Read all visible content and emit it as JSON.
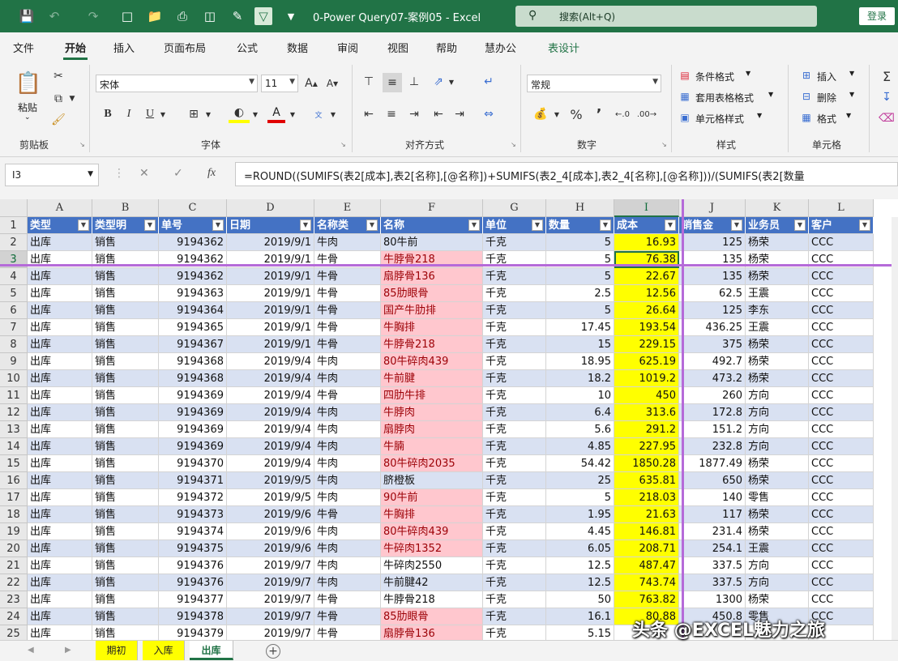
{
  "title_bar": {
    "doc_title": "0-Power Query07-案例05 - Excel",
    "search_placeholder": "搜索(Alt+Q)",
    "login_label": "登录"
  },
  "ribbon_tabs": [
    "文件",
    "开始",
    "插入",
    "页面布局",
    "公式",
    "数据",
    "审阅",
    "视图",
    "帮助",
    "慧办公",
    "表设计"
  ],
  "ribbon": {
    "clipboard": {
      "paste_label": "粘贴",
      "group_label": "剪贴板"
    },
    "font": {
      "name": "宋体",
      "size": "11",
      "group_label": "字体",
      "bold": "B",
      "italic": "I",
      "underline": "U"
    },
    "align": {
      "group_label": "对齐方式"
    },
    "number": {
      "format": "常规",
      "group_label": "数字",
      "percent": "%"
    },
    "styles": {
      "cond_format": "条件格式",
      "table_format": "套用表格格式",
      "cell_style": "单元格样式",
      "group_label": "样式"
    },
    "cells": {
      "insert": "插入",
      "delete": "删除",
      "format": "格式",
      "group_label": "单元格"
    }
  },
  "formula_bar": {
    "name_box": "I3",
    "fx": "fx",
    "formula": "=ROUND((SUMIFS(表2[成本],表2[名称],[@名称])+SUMIFS(表2_4[成本],表2_4[名称],[@名称]))/(SUMIFS(表2[数量"
  },
  "columns": [
    "A",
    "B",
    "C",
    "D",
    "E",
    "F",
    "G",
    "H",
    "I",
    "J",
    "K",
    "L"
  ],
  "table": {
    "headers": [
      "类型",
      "类型明",
      "单号",
      "日期",
      "名称类",
      "名称",
      "单位",
      "数量",
      "成本",
      "销售金",
      "业务员",
      "客户"
    ],
    "rows": [
      [
        "出库",
        "销售",
        "9194362",
        "2019/9/1",
        "牛肉",
        "80牛前",
        "千克",
        "5",
        "16.93",
        "125",
        "杨荣",
        "CCC"
      ],
      [
        "出库",
        "销售",
        "9194362",
        "2019/9/1",
        "牛骨",
        "牛脖骨218",
        "千克",
        "5",
        "76.38",
        "135",
        "杨荣",
        "CCC"
      ],
      [
        "出库",
        "销售",
        "9194362",
        "2019/9/1",
        "牛骨",
        "扇脖骨136",
        "千克",
        "5",
        "22.67",
        "135",
        "杨荣",
        "CCC"
      ],
      [
        "出库",
        "销售",
        "9194363",
        "2019/9/1",
        "牛骨",
        "85肋眼骨",
        "千克",
        "2.5",
        "12.56",
        "62.5",
        "王震",
        "CCC"
      ],
      [
        "出库",
        "销售",
        "9194364",
        "2019/9/1",
        "牛骨",
        "国产牛肋排",
        "千克",
        "5",
        "26.64",
        "125",
        "李东",
        "CCC"
      ],
      [
        "出库",
        "销售",
        "9194365",
        "2019/9/1",
        "牛骨",
        "牛胸排",
        "千克",
        "17.45",
        "193.54",
        "436.25",
        "王震",
        "CCC"
      ],
      [
        "出库",
        "销售",
        "9194367",
        "2019/9/1",
        "牛骨",
        "牛脖骨218",
        "千克",
        "15",
        "229.15",
        "375",
        "杨荣",
        "CCC"
      ],
      [
        "出库",
        "销售",
        "9194368",
        "2019/9/4",
        "牛肉",
        "80牛碎肉439",
        "千克",
        "18.95",
        "625.19",
        "492.7",
        "杨荣",
        "CCC"
      ],
      [
        "出库",
        "销售",
        "9194368",
        "2019/9/4",
        "牛肉",
        "牛前腱",
        "千克",
        "18.2",
        "1019.2",
        "473.2",
        "杨荣",
        "CCC"
      ],
      [
        "出库",
        "销售",
        "9194369",
        "2019/9/4",
        "牛骨",
        "四肋牛排",
        "千克",
        "10",
        "450",
        "260",
        "方向",
        "CCC"
      ],
      [
        "出库",
        "销售",
        "9194369",
        "2019/9/4",
        "牛肉",
        "牛脖肉",
        "千克",
        "6.4",
        "313.6",
        "172.8",
        "方向",
        "CCC"
      ],
      [
        "出库",
        "销售",
        "9194369",
        "2019/9/4",
        "牛肉",
        "扇脖肉",
        "千克",
        "5.6",
        "291.2",
        "151.2",
        "方向",
        "CCC"
      ],
      [
        "出库",
        "销售",
        "9194369",
        "2019/9/4",
        "牛肉",
        "牛腩",
        "千克",
        "4.85",
        "227.95",
        "232.8",
        "方向",
        "CCC"
      ],
      [
        "出库",
        "销售",
        "9194370",
        "2019/9/4",
        "牛肉",
        "80牛碎肉2035",
        "千克",
        "54.42",
        "1850.28",
        "1877.49",
        "杨荣",
        "CCC"
      ],
      [
        "出库",
        "销售",
        "9194371",
        "2019/9/5",
        "牛肉",
        "脐橙板",
        "千克",
        "25",
        "635.81",
        "650",
        "杨荣",
        "CCC"
      ],
      [
        "出库",
        "销售",
        "9194372",
        "2019/9/5",
        "牛肉",
        "90牛前",
        "千克",
        "5",
        "218.03",
        "140",
        "零售",
        "CCC"
      ],
      [
        "出库",
        "销售",
        "9194373",
        "2019/9/6",
        "牛骨",
        "牛胸排",
        "千克",
        "1.95",
        "21.63",
        "117",
        "杨荣",
        "CCC"
      ],
      [
        "出库",
        "销售",
        "9194374",
        "2019/9/6",
        "牛肉",
        "80牛碎肉439",
        "千克",
        "4.45",
        "146.81",
        "231.4",
        "杨荣",
        "CCC"
      ],
      [
        "出库",
        "销售",
        "9194375",
        "2019/9/6",
        "牛肉",
        "牛碎肉1352",
        "千克",
        "6.05",
        "208.71",
        "254.1",
        "王震",
        "CCC"
      ],
      [
        "出库",
        "销售",
        "9194376",
        "2019/9/7",
        "牛肉",
        "牛碎肉2550",
        "千克",
        "12.5",
        "487.47",
        "337.5",
        "方向",
        "CCC"
      ],
      [
        "出库",
        "销售",
        "9194376",
        "2019/9/7",
        "牛肉",
        "牛前腱42",
        "千克",
        "12.5",
        "743.74",
        "337.5",
        "方向",
        "CCC"
      ],
      [
        "出库",
        "销售",
        "9194377",
        "2019/9/7",
        "牛骨",
        "牛脖骨218",
        "千克",
        "50",
        "763.82",
        "1300",
        "杨荣",
        "CCC"
      ],
      [
        "出库",
        "销售",
        "9194378",
        "2019/9/7",
        "牛骨",
        "85肋眼骨",
        "千克",
        "16.1",
        "80.88",
        "450.8",
        "零售",
        "CCC"
      ],
      [
        "出库",
        "销售",
        "9194379",
        "2019/9/7",
        "牛骨",
        "扇脖骨136",
        "千克",
        "5.15",
        "",
        "",
        "",
        ""
      ]
    ],
    "pink_rows": [
      1,
      2,
      3,
      4,
      5,
      6,
      7,
      8,
      9,
      10,
      11,
      12,
      13,
      15,
      16,
      17,
      18,
      22,
      23,
      24
    ],
    "selected_row": 3
  },
  "sheet_tabs": [
    "期初",
    "入库",
    "出库"
  ],
  "watermark": "头条 @EXCEL魅力之旅"
}
